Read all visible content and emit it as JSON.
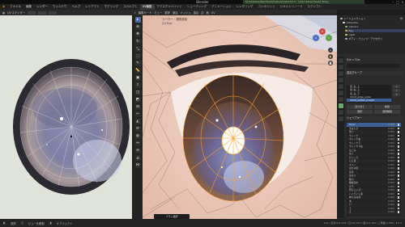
{
  "window": {
    "title": "Blender"
  },
  "menubar": {
    "items": [
      "ファイル",
      "編集",
      "レンダー",
      "ウィンドウ",
      "ヘルプ"
    ],
    "workspaces": [
      "レイアウト",
      "モデリング",
      "スカルプト",
      "UV編集",
      "テクスチャペイント",
      "シェーディング",
      "アニメーション",
      "レンダリング",
      "コンポジット",
      "ジオメトリノード",
      "スクリプト"
    ],
    "active_workspace": "UV編集"
  },
  "image_editor": {
    "header": "UV エディター"
  },
  "viewport": {
    "header_items": [
      "編集モード",
      "ビュー",
      "選択",
      "追加",
      "メッシュ",
      "頂点",
      "辺",
      "面",
      "UV"
    ],
    "overlay_line1": "ユーザー・透視投影",
    "overlay_line2": "(1) Eye"
  },
  "notification": {
    "text": "Somewhere/Rendered/Output/Collection1 - [Auto Save] Saved Today"
  },
  "outliner": {
    "rows": [
      {
        "label": "シーンコレクション",
        "color": "#bbbbbb"
      },
      {
        "label": "Collection",
        "color": "#e5e5e5"
      },
      {
        "label": "Camera",
        "color": "#7fbf7f"
      },
      {
        "label": "Eye",
        "color": "#e59b3a"
      },
      {
        "label": "Light",
        "color": "#e0d060"
      },
      {
        "label": "ボディ・フェイス・アクセサリ",
        "color": "#9fb7e0"
      }
    ]
  },
  "properties": {
    "breadcrumb": "Eye  >  Eye",
    "vertex_groups": {
      "title": "頂点グループ",
      "items": [
        "目_左_上",
        "目_右_上",
        "目_左_下",
        "mmd_edge_scale",
        "mmd_vertex_morph"
      ],
      "selected": 4,
      "buttons": [
        "割り当て",
        "削除",
        "選択",
        "選択解除"
      ]
    },
    "shape_keys": {
      "title": "シェイプキー",
      "items": [
        {
          "name": "Basis",
          "value": "0.000"
        },
        {
          "name": "まばたき",
          "value": "0.000"
        },
        {
          "name": "笑い",
          "value": "0.000"
        },
        {
          "name": "ウィンク",
          "value": "0.000"
        },
        {
          "name": "ウィンク右",
          "value": "0.000"
        },
        {
          "name": "ウィンク２",
          "value": "0.000"
        },
        {
          "name": "ウィンク２右",
          "value": "0.000"
        },
        {
          "name": "なごみ",
          "value": "0.000"
        },
        {
          "name": "はぅ",
          "value": "0.000"
        },
        {
          "name": "びっくり",
          "value": "0.000"
        },
        {
          "name": "じと目",
          "value": "0.000"
        },
        {
          "name": "キリッ",
          "value": "0.000"
        },
        {
          "name": "はちゅ目",
          "value": "0.000"
        },
        {
          "name": "星目",
          "value": "0.000"
        },
        {
          "name": "はぁと",
          "value": "0.000"
        },
        {
          "name": "瞳小",
          "value": "0.000"
        },
        {
          "name": "瞳縦潰れ",
          "value": "0.000"
        },
        {
          "name": "光下",
          "value": "0.000"
        },
        {
          "name": "恐ろしい子！",
          "value": "0.000"
        },
        {
          "name": "ハイライト消",
          "value": "0.000"
        },
        {
          "name": "映り込み消",
          "value": "0.000"
        },
        {
          "name": "あ",
          "value": "0.000"
        },
        {
          "name": "い",
          "value": "0.000"
        },
        {
          "name": "う",
          "value": "0.000"
        },
        {
          "name": "え",
          "value": "0.000"
        }
      ]
    }
  },
  "viewport_footer": "ブラシ選択",
  "statusbar": {
    "items": [
      "選択",
      "ビューを移動",
      "オブジェクト"
    ],
    "version": "Eye | 頂点:0/1,248 | 辺:0/2,437 | 面:0/1,190 | 三角面:2,380 | 4.0.2"
  },
  "colors": {
    "selection_orange": "#ff9e2c",
    "accent_blue": "#3e5f96",
    "skin": "#e8c8ba",
    "iris_brown": "#7a5540"
  }
}
